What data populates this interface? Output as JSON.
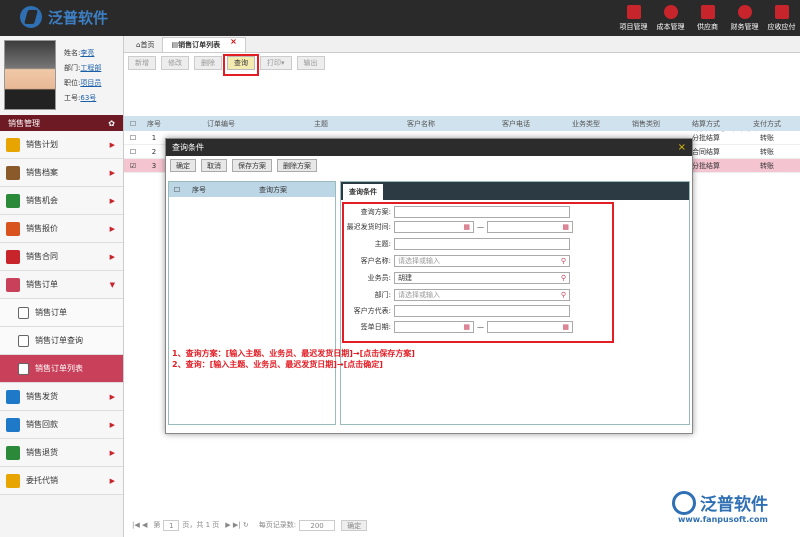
{
  "app": {
    "name": "泛普软件"
  },
  "topnav": [
    {
      "label": "项目管理"
    },
    {
      "label": "成本管理"
    },
    {
      "label": "供应商"
    },
    {
      "label": "财务管理"
    },
    {
      "label": "应收应付"
    }
  ],
  "user": {
    "name_label": "姓名:",
    "name": "李亮",
    "dept_label": "部门:",
    "dept": "工程部",
    "post_label": "职位:",
    "post": "项目员",
    "no_label": "工号:",
    "no": "63号"
  },
  "sidebar": {
    "section": "销售管理",
    "items": [
      {
        "label": "销售计划",
        "color": "#e8a400"
      },
      {
        "label": "销售档案",
        "color": "#8a5a2b"
      },
      {
        "label": "销售机会",
        "color": "#2a8a3a"
      },
      {
        "label": "销售报价",
        "color": "#d9531e"
      },
      {
        "label": "销售合同",
        "color": "#c8242c"
      },
      {
        "label": "销售订单",
        "color": "#c8405a"
      }
    ],
    "subitems": [
      {
        "label": "销售订单"
      },
      {
        "label": "销售订单查询"
      },
      {
        "label": "销售订单列表"
      }
    ],
    "items2": [
      {
        "label": "销售发货",
        "color": "#1e7ac8"
      },
      {
        "label": "销售回款",
        "color": "#1e7ac8"
      },
      {
        "label": "销售退货",
        "color": "#2a8a3a"
      },
      {
        "label": "委托代销",
        "color": "#e8a400"
      }
    ]
  },
  "tabs": {
    "home": "首页",
    "current": "销售订单列表"
  },
  "toolbar": {
    "new": "新增",
    "edit": "修改",
    "delete": "删除",
    "query": "查询",
    "print": "打印",
    "export": "输出"
  },
  "page": {
    "title": "销售订单列表"
  },
  "grid": {
    "headers": [
      "序号",
      "订单编号",
      "主题",
      "客户名称",
      "客户电话",
      "业务类型",
      "销售类别",
      "结算方式",
      "支付方式"
    ],
    "rows": [
      {
        "no": "1",
        "settle": "分批结算",
        "pay": "转账"
      },
      {
        "no": "2",
        "settle": "合同结算",
        "pay": "转账"
      },
      {
        "no": "3",
        "settle": "分批结算",
        "pay": "转账"
      }
    ]
  },
  "dialog": {
    "title": "查询条件",
    "buttons": {
      "ok": "确定",
      "cancel": "取消",
      "save": "保存方案",
      "delete": "删除方案"
    },
    "left_headers": {
      "no": "序号",
      "scheme": "查询方案"
    },
    "tab": "查询条件",
    "fields": {
      "scheme": "查询方案:",
      "ship": "最迟发货时间:",
      "subject": "主题:",
      "customer": "客户名称:",
      "customer_ph": "请选择或输入",
      "salesman": "业务员:",
      "salesman_val": "胡建",
      "dept": "部门:",
      "dept_ph": "请选择或输入",
      "rep": "客户方代表:",
      "sign": "签单日期:"
    }
  },
  "notes": [
    "1、查询方案：[输入主题、业务员、最迟发货日期]→[点击保存方案]",
    "2、查询：[输入主题、业务员、最迟发货日期]→[点击确定]"
  ],
  "pager": {
    "page_label": "第",
    "page": "1",
    "of": "页，共 1 页",
    "per_label": "每页记录数:",
    "per": "200",
    "go": "确定"
  },
  "brand": {
    "name": "泛普软件",
    "url": "www.fanpusoft.com"
  }
}
